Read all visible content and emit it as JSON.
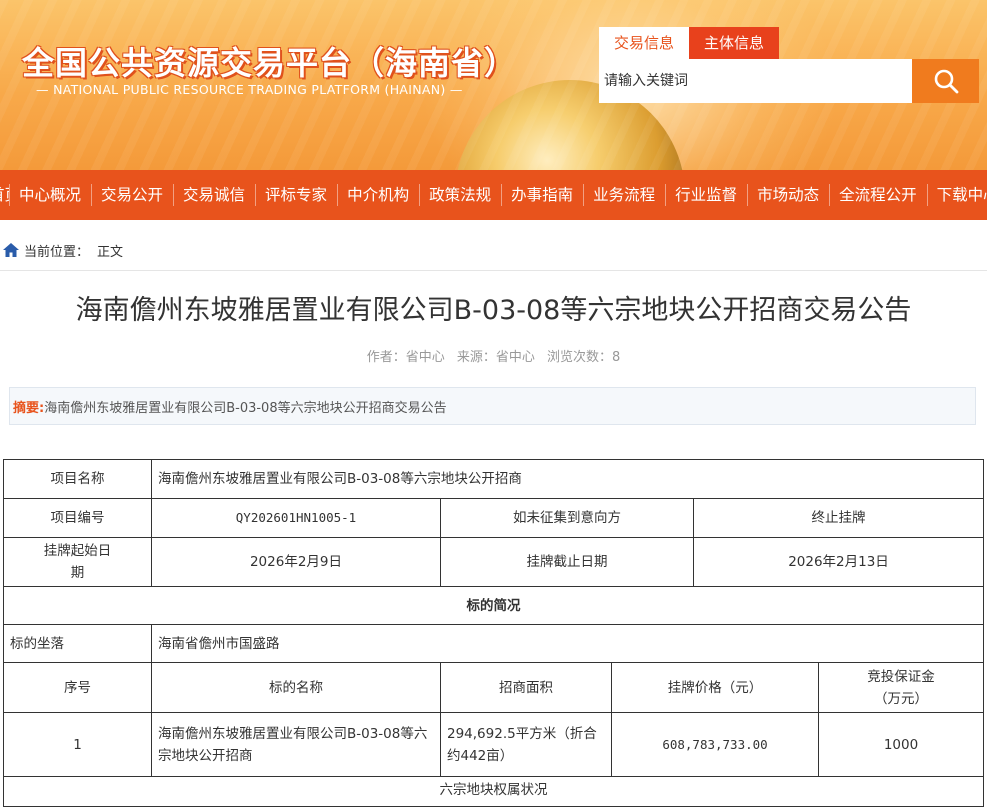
{
  "header": {
    "title": "全国公共资源交易平台（海南省）",
    "subtitle": "— NATIONAL PUBLIC RESOURCE TRADING PLATFORM (HAINAN) —"
  },
  "search": {
    "tabs": [
      "交易信息",
      "主体信息"
    ],
    "placeholder": "请输入关键词",
    "icon": "search-icon"
  },
  "nav": {
    "items": [
      "首页",
      "中心概况",
      "交易公开",
      "交易诚信",
      "评标专家",
      "中介机构",
      "政策法规",
      "办事指南",
      "业务流程",
      "行业监督",
      "市场动态",
      "全流程公开",
      "下载中心"
    ]
  },
  "breadcrumb": {
    "label": "当前位置：",
    "current": "正文",
    "icon": "home-icon"
  },
  "article": {
    "title": "海南儋州东坡雅居置业有限公司B-03-08等六宗地块公开招商交易公告",
    "meta": {
      "author": "作者：省中心",
      "source": "来源：省中心",
      "views": "浏览次数：8"
    },
    "summary_label": "摘要:",
    "summary_text": "海南儋州东坡雅居置业有限公司B-03-08等六宗地块公开招商交易公告"
  },
  "table": {
    "project_name_label": "项目名称",
    "project_name": "海南儋州东坡雅居置业有限公司B-03-08等六宗地块公开招商",
    "project_no_label": "项目编号",
    "project_no": "QY202601HN1005-1",
    "no_intent_label": "如未征集到意向方",
    "no_intent_value": "终止挂牌",
    "start_date_label": "挂牌起始日期",
    "start_date": "2026年2月9日",
    "end_date_label": "挂牌截止日期",
    "end_date": "2026年2月13日",
    "overview_title": "标的简况",
    "location_label": "标的坐落",
    "location": "海南省儋州市国盛路",
    "columns": [
      "序号",
      "标的名称",
      "招商面积",
      "挂牌价格（元）",
      "竞投保证金（万元）"
    ],
    "rows": [
      {
        "no": "1",
        "name": "海南儋州东坡雅居置业有限公司B-03-08等六宗地块公开招商",
        "area": "294,692.5平方米（折合约442亩）",
        "price": "608,783,733.00",
        "deposit": "1000"
      }
    ],
    "next_section": "六宗地块权属状况"
  },
  "colors": {
    "brand_orange": "#e8531c",
    "search_button": "#f07b1e"
  }
}
